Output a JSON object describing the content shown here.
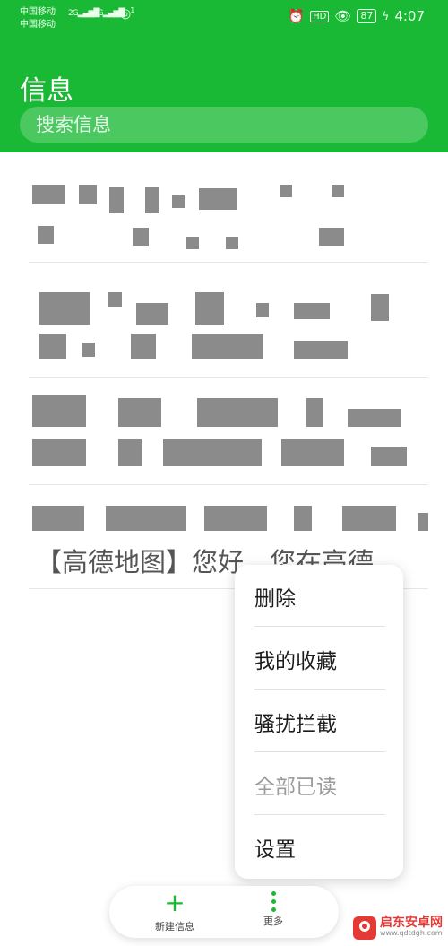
{
  "status_bar": {
    "carrier_1": "中国移动",
    "carrier_2": "中国移动",
    "signal_1": "2G",
    "signal_2": "4G",
    "wifi_count": "1",
    "battery": "87",
    "time": "4:07"
  },
  "header": {
    "title": "信息",
    "search_placeholder": "搜索信息"
  },
  "conversations": {
    "last_preview": "【高德地图】您好，您在高德..."
  },
  "menu": {
    "items": [
      {
        "label": "删除"
      },
      {
        "label": "我的收藏"
      },
      {
        "label": "骚扰拦截"
      },
      {
        "label": "全部已读"
      },
      {
        "label": "设置"
      }
    ]
  },
  "bottom_bar": {
    "new_message_label": "新建信息",
    "more_label": "更多"
  },
  "watermark": {
    "name": "启东安卓网",
    "url": "www.qdtdgh.com"
  },
  "colors": {
    "accent": "#1ab935",
    "menu_disabled": "#9a9a9a"
  }
}
